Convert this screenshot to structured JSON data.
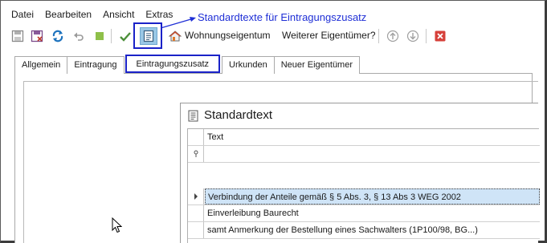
{
  "menu": {
    "items": [
      "Datei",
      "Bearbeiten",
      "Ansicht",
      "Extras"
    ]
  },
  "annotation": {
    "callout_text": "Standardtexte für Eintragungszusatz",
    "color": "#1f2fd6"
  },
  "toolbar": {
    "buttons": [
      {
        "icon": "save-icon"
      },
      {
        "icon": "save-close-icon"
      },
      {
        "icon": "refresh-icon"
      },
      {
        "icon": "undo-icon"
      },
      {
        "icon": "stop-icon"
      },
      {
        "icon": "checkmark-icon"
      },
      {
        "icon": "document-list-icon"
      },
      {
        "icon": "house-icon"
      },
      {
        "icon": "arrow-up-circle-icon"
      },
      {
        "icon": "arrow-down-circle-icon"
      },
      {
        "icon": "close-x-icon"
      }
    ],
    "wohnungseigentum_label": "Wohnungseigentum",
    "weiterer_label": "Weiterer Eigentümer?"
  },
  "tabs": [
    {
      "label": "Allgemein",
      "active": false
    },
    {
      "label": "Eintragung",
      "active": false
    },
    {
      "label": "Eintragungszusatz",
      "active": true
    },
    {
      "label": "Urkunden",
      "active": false
    },
    {
      "label": "Neuer Eigentümer",
      "active": false
    }
  ],
  "dialog": {
    "title": "Standardtext",
    "column_header": "Text",
    "rows": [
      "Verbindung der Anteile gemäß § 5 Abs. 3, § 13 Abs  3 WEG 2002",
      "Einverleibung Baurecht",
      "samt Anmerkung der Bestellung eines Sachwalters (1P100/98, BG...)"
    ],
    "selected_row": 0
  },
  "colors": {
    "highlight_border": "#1a22c8",
    "selected_row_bg": "#cfe4f7",
    "active_button_bg": "#9ac8e6"
  }
}
